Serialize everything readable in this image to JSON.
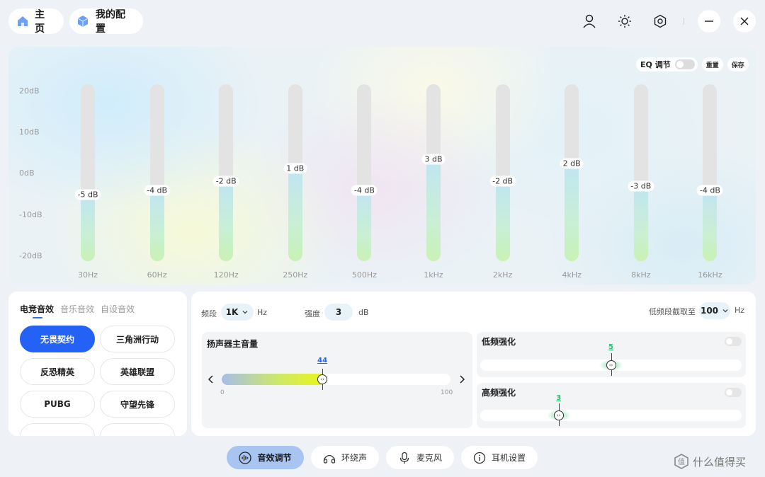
{
  "header": {
    "home_label": "主页",
    "config_label": "我的配置",
    "home_icon": "home-icon",
    "config_icon": "cube-icon",
    "user_icon": "user-icon",
    "brightness_icon": "brightness-icon",
    "settings_icon": "settings-icon",
    "minimize_icon": "minimize-icon",
    "close_icon": "close-icon"
  },
  "eq": {
    "toggle_label": "EQ 调节",
    "toggle_on": false,
    "reset_label": "重置",
    "save_label": "保存",
    "y_labels": [
      "20dB",
      "10dB",
      "0dB",
      "-10dB",
      "-20dB"
    ],
    "range": [
      -20,
      20
    ],
    "bands": [
      {
        "freq": "30Hz",
        "db": -5,
        "label": "-5 dB"
      },
      {
        "freq": "60Hz",
        "db": -4,
        "label": "-4 dB"
      },
      {
        "freq": "120Hz",
        "db": -2,
        "label": "-2 dB"
      },
      {
        "freq": "250Hz",
        "db": 1,
        "label": "1 dB"
      },
      {
        "freq": "500Hz",
        "db": -4,
        "label": "-4 dB"
      },
      {
        "freq": "1kHz",
        "db": 3,
        "label": "3 dB"
      },
      {
        "freq": "2kHz",
        "db": -2,
        "label": "-2 dB"
      },
      {
        "freq": "4kHz",
        "db": 2,
        "label": "2 dB"
      },
      {
        "freq": "8kHz",
        "db": -3,
        "label": "-3 dB"
      },
      {
        "freq": "16kHz",
        "db": -4,
        "label": "-4 dB"
      }
    ]
  },
  "presets": {
    "tabs": [
      "电竞音效",
      "音乐音效",
      "自设音效"
    ],
    "active_tab": 0,
    "items": [
      "无畏契约",
      "三角洲行动",
      "反恐精英",
      "英雄联盟",
      "PUBG",
      "守望先锋"
    ],
    "active_item": 0
  },
  "mixer": {
    "band_label": "频段",
    "band_value": "1K",
    "band_unit": "Hz",
    "strength_label": "强度",
    "strength_value": "3",
    "strength_unit": "dB",
    "lowcut_label": "低频段截取至",
    "lowcut_value": "100",
    "lowcut_unit": "Hz",
    "master": {
      "title": "扬声器主音量",
      "value": "44",
      "min": "0",
      "max": "100",
      "level": 44
    },
    "bass": {
      "title": "低频强化",
      "value": "5",
      "level": 0.5,
      "enabled": false
    },
    "treble": {
      "title": "高频强化",
      "value": "3",
      "level": 0.3,
      "enabled": false
    }
  },
  "nav": [
    {
      "label": "音效调节",
      "icon": "audio-wave-icon",
      "active": true
    },
    {
      "label": "环绕声",
      "icon": "headphones-icon",
      "active": false
    },
    {
      "label": "麦克风",
      "icon": "microphone-icon",
      "active": false
    },
    {
      "label": "耳机设置",
      "icon": "info-icon",
      "active": false
    }
  ],
  "watermark": "什么值得买",
  "colors": {
    "accent": "#2462f5",
    "nav_active": "#a8c4f0",
    "glow": "#46c882"
  }
}
